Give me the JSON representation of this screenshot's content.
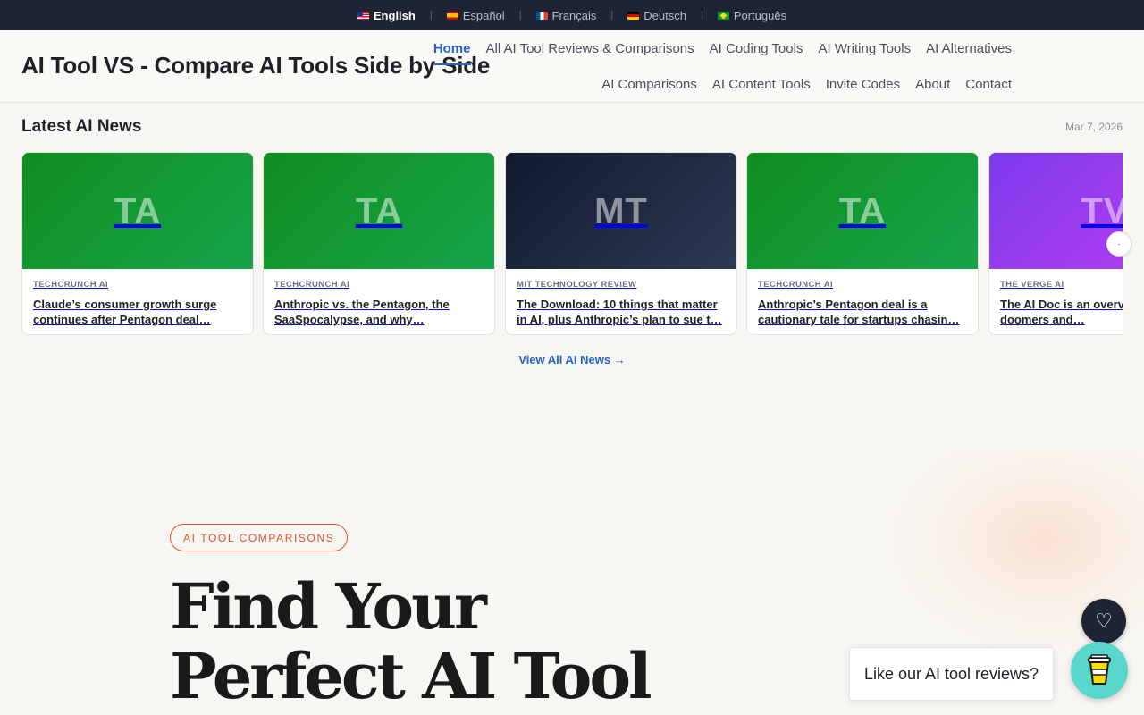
{
  "languages": [
    {
      "label": "English",
      "flag": "us-flag-icon",
      "active": true
    },
    {
      "label": "Español",
      "flag": "es-flag-icon",
      "active": false
    },
    {
      "label": "Français",
      "flag": "fr-flag-icon",
      "active": false
    },
    {
      "label": "Deutsch",
      "flag": "de-flag-icon",
      "active": false
    },
    {
      "label": "Português",
      "flag": "br-flag-icon",
      "active": false
    }
  ],
  "header": {
    "title": "AI Tool VS - Compare AI Tools Side by Side",
    "nav_row1": [
      "Home",
      "All AI Tool Reviews & Comparisons",
      "AI Coding Tools",
      "AI Writing Tools",
      "AI Alternatives"
    ],
    "nav_row2": [
      "AI Comparisons",
      "AI Content Tools",
      "Invite Codes",
      "About",
      "Contact"
    ],
    "active_item": "Home"
  },
  "news": {
    "title": "Latest AI News",
    "date": "Mar 7, 2026",
    "view_all": "View All AI News →",
    "cards": [
      {
        "initials": "TA",
        "color": "green",
        "source": "TECHCRUNCH AI",
        "headline": "Claude’s consumer growth surge continues after Pentagon deal…"
      },
      {
        "initials": "TA",
        "color": "green",
        "source": "TECHCRUNCH AI",
        "headline": "Anthropic vs. the Pentagon, the SaaSpocalypse, and why…"
      },
      {
        "initials": "MT",
        "color": "dark",
        "source": "MIT TECHNOLOGY REVIEW",
        "headline": "The Download: 10 things that matter in AI, plus Anthropic’s plan to sue t…"
      },
      {
        "initials": "TA",
        "color": "green",
        "source": "TECHCRUNCH AI",
        "headline": "Anthropic’s Pentagon deal is a cautionary tale for startups chasin…"
      },
      {
        "initials": "TV",
        "color": "purple",
        "source": "THE VERGE AI",
        "headline": "The AI Doc is an overview piece for doomers and…"
      }
    ]
  },
  "hero": {
    "badge": "AI TOOL COMPARISONS",
    "title_line1": "Find Your",
    "title_line2": "Perfect AI Tool"
  },
  "widgets": {
    "tooltip": "Like our AI tool reviews?",
    "heart_icon": "heart-icon",
    "cup_icon": "coffee-cup-icon"
  },
  "colors": {
    "accent": "#2563c9",
    "badge": "#d9542c",
    "topbar": "#1e2433",
    "cup_button": "#5ad7cc"
  }
}
